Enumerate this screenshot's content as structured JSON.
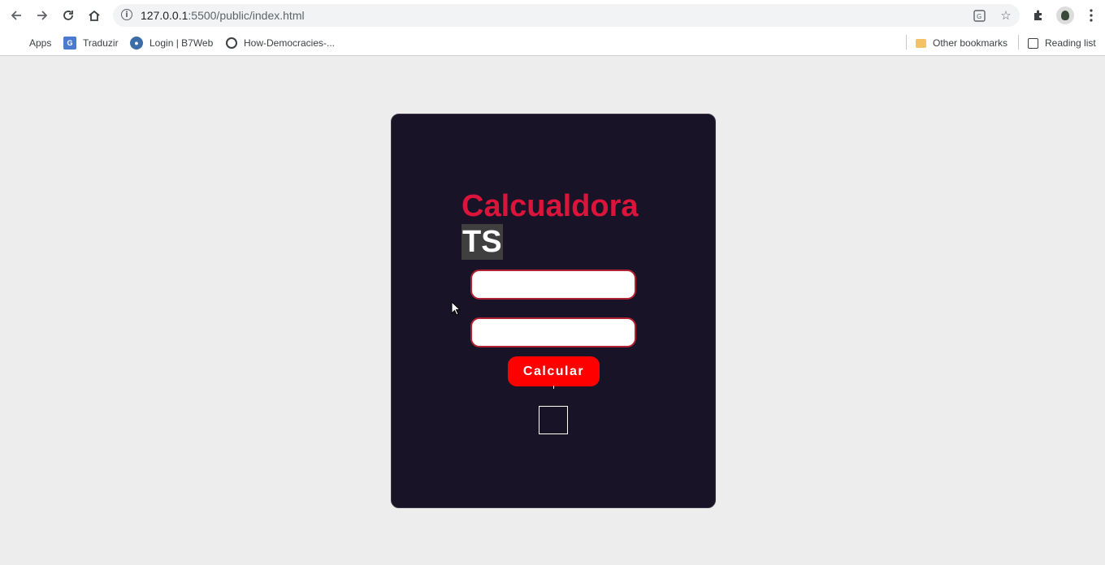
{
  "browser": {
    "url_host": "127.0.0.1",
    "url_rest": ":5500/public/index.html",
    "nav": {
      "back_icon": "arrow-left",
      "forward_icon": "arrow-right",
      "reload_icon": "reload",
      "home_icon": "home"
    }
  },
  "bookmarks": {
    "items": [
      {
        "label": "Apps",
        "icon": "apps-grid-icon"
      },
      {
        "label": "Traduzir",
        "icon": "translate-icon"
      },
      {
        "label": "Login | B7Web",
        "icon": "login-site-icon"
      },
      {
        "label": "How-Democracies-...",
        "icon": "globe-icon"
      }
    ],
    "other_bookmarks": "Other bookmarks",
    "reading_list": "Reading list"
  },
  "app": {
    "title_main": "Calcualdora",
    "title_ts": "TS",
    "input1_value": "",
    "input2_value": "",
    "calc_button_label": "Calcular",
    "result_text": ""
  },
  "colors": {
    "page_background": "#ededed",
    "card_background": "#181326",
    "title_color": "#dc143c",
    "button_color": "#ff0000",
    "input_border": "#b22232"
  }
}
